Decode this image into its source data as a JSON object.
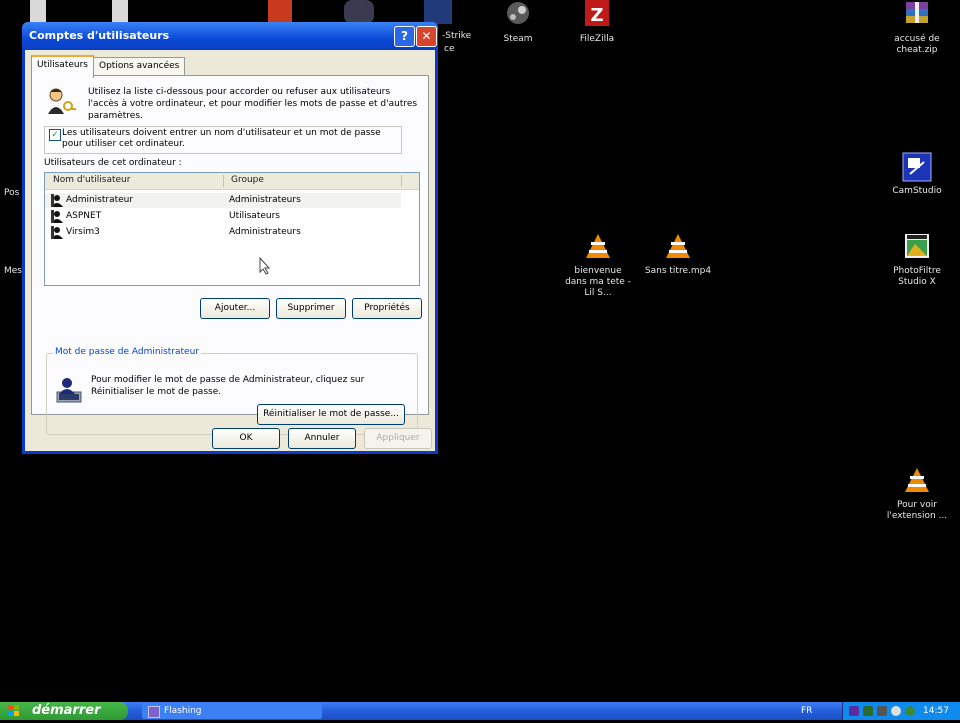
{
  "desktop": {
    "icons": [
      {
        "label": "Steam",
        "icon": "steam-icon"
      },
      {
        "label": "FileZilla",
        "icon": "filezilla-icon"
      },
      {
        "label": "accusé de cheat.zip",
        "icon": "winrar-archive-icon"
      },
      {
        "label": "CamStudio",
        "icon": "camstudio-icon"
      },
      {
        "label": "bienvenue dans ma tete - Lil S...",
        "icon": "vlc-icon"
      },
      {
        "label": "Sans titre.mp4",
        "icon": "vlc-icon"
      },
      {
        "label": "PhotoFiltre Studio X",
        "icon": "photofiltre-icon"
      },
      {
        "label": "Pour voir l'extension ...",
        "icon": "vlc-icon"
      }
    ],
    "partial_labels": [
      "-Strike",
      "ce",
      "Pos",
      "Mes"
    ]
  },
  "dialog": {
    "title": "Comptes d'utilisateurs",
    "help_glyph": "?",
    "close_glyph": "✕",
    "tabs": [
      {
        "label": "Utilisateurs",
        "active": true
      },
      {
        "label": "Options avancées",
        "active": false
      }
    ],
    "intro": "Utilisez la liste ci-dessous pour accorder ou refuser aux utilisateurs l'accès à votre ordinateur, et pour modifier les mots de passe et d'autres paramètres.",
    "must_login_checked": true,
    "check_glyph": "✓",
    "must_login_label": "Les utilisateurs doivent entrer un nom d'utilisateur et un mot de passe pour utiliser cet ordinateur.",
    "list_label": "Utilisateurs de cet ordinateur :",
    "columns": [
      "Nom d'utilisateur",
      "Groupe"
    ],
    "users": [
      {
        "name": "Administrateur",
        "group": "Administrateurs"
      },
      {
        "name": "ASPNET",
        "group": "Utilisateurs"
      },
      {
        "name": "Virsim3",
        "group": "Administrateurs"
      }
    ],
    "buttons": {
      "add": "Ajouter...",
      "remove": "Supprimer",
      "properties": "Propriétés",
      "reset_password": "Réinitialiser le mot de passe...",
      "ok": "OK",
      "cancel": "Annuler",
      "apply": "Appliquer"
    },
    "password_group": {
      "legend": "Mot de passe de Administrateur",
      "text": "Pour modifier le mot de passe de Administrateur, cliquez sur Réinitialiser le mot de passe."
    }
  },
  "taskbar": {
    "start_label": "démarrer",
    "tasks": [
      {
        "label": "Flashing"
      }
    ],
    "language": "FR",
    "clock": "14:57"
  },
  "colors": {
    "titlebar": "#0a4ad8",
    "start_button": "#45b649",
    "taskbar": "#245edb",
    "vlc_cone": "#f08a00"
  }
}
